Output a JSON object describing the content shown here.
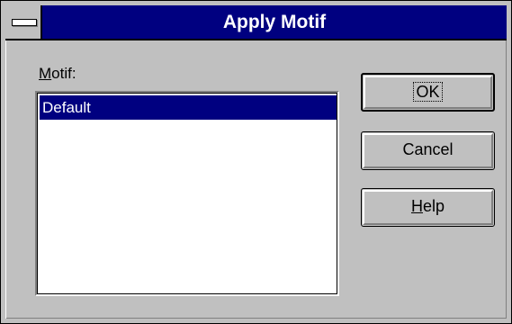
{
  "window": {
    "title": "Apply Motif"
  },
  "motif": {
    "label_prefix": "M",
    "label_rest": "otif:",
    "items": [
      "Default"
    ],
    "selected": "Default"
  },
  "buttons": {
    "ok": "OK",
    "cancel": "Cancel",
    "help_prefix": "H",
    "help_rest": "elp"
  },
  "colors": {
    "titlebar": "#000080",
    "face": "#c0c0c0",
    "selection": "#000080"
  }
}
